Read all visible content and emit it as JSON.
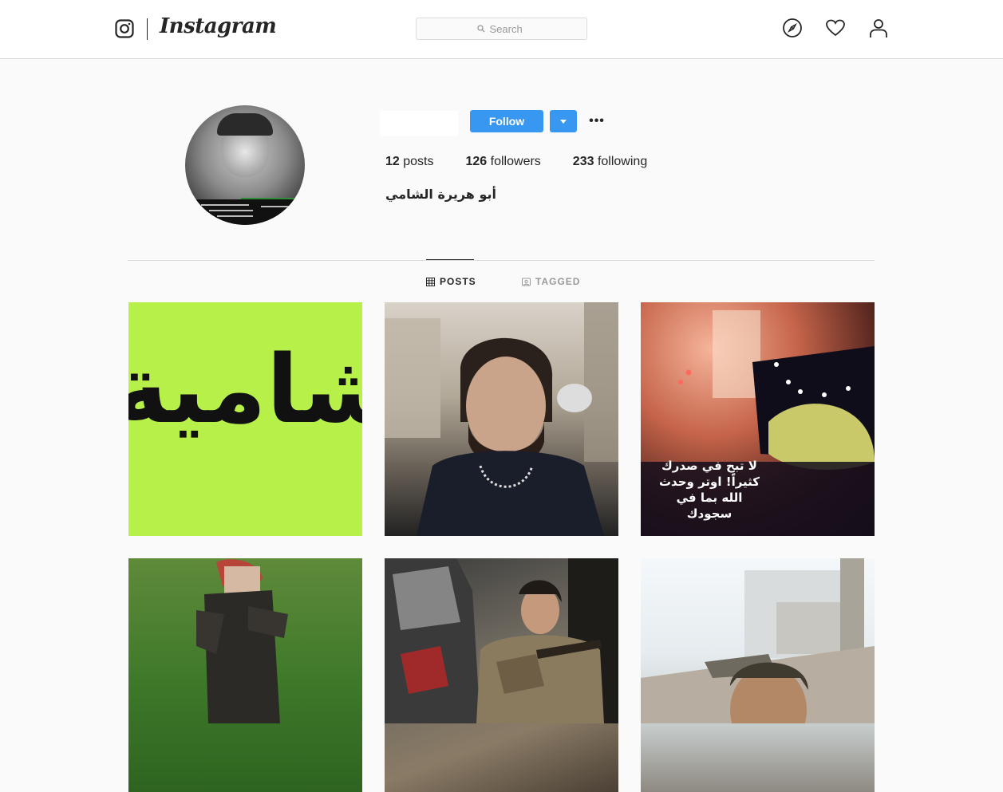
{
  "nav": {
    "wordmark": "Instagram",
    "search": {
      "placeholder": "Search"
    },
    "icons": [
      "instagram-camera-icon",
      "explore-compass-icon",
      "activity-heart-icon",
      "profile-person-icon"
    ]
  },
  "profile": {
    "follow_label": "Follow",
    "more_label": "•••",
    "stats": {
      "posts_count": "12",
      "posts_label": "posts",
      "followers_count": "126",
      "followers_label": "followers",
      "following_count": "233",
      "following_label": "following"
    },
    "full_name": "أبو هريرة الشامي"
  },
  "tabs": [
    {
      "label": "POSTS",
      "active": true,
      "icon": "grid-icon"
    },
    {
      "label": "TAGGED",
      "active": false,
      "icon": "tag-portrait-icon"
    }
  ],
  "posts": [
    {
      "text": "شامية"
    },
    {},
    {
      "text": "لا تبح في صدرك كثيراً! اوتر وحدث الله بما في سجودك"
    },
    {},
    {},
    {}
  ],
  "colors": {
    "accent": "#3897f0",
    "border": "#dbdbdb",
    "background": "#fafafa",
    "text": "#262626",
    "muted": "#999999"
  }
}
